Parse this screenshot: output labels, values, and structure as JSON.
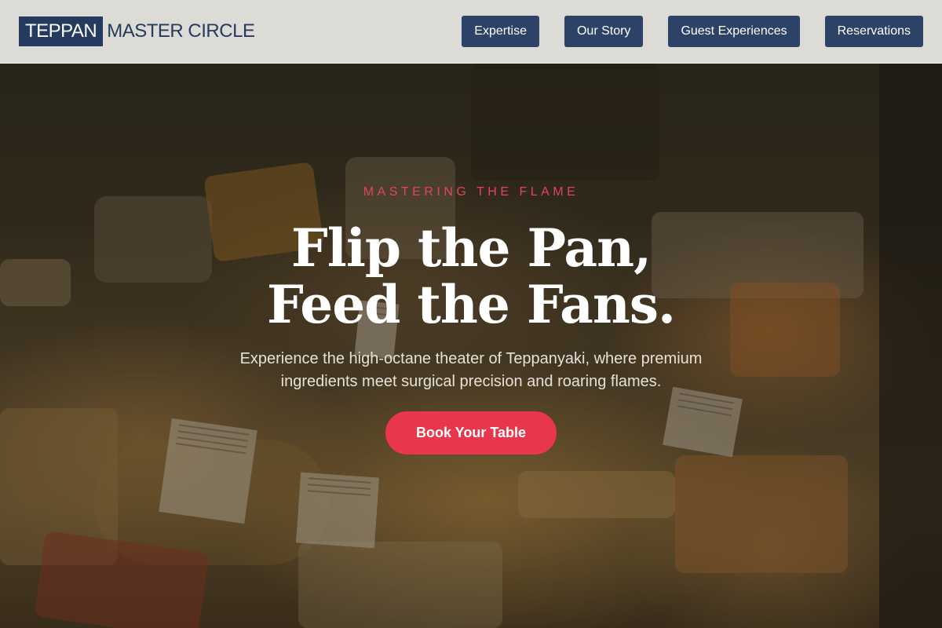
{
  "brand": {
    "logo_box_text": "TEPPAN",
    "logo_rest_text": "MASTER CIRCLE"
  },
  "nav": {
    "items": [
      {
        "label": "Expertise"
      },
      {
        "label": "Our Story"
      },
      {
        "label": "Guest Experiences"
      },
      {
        "label": "Reservations"
      }
    ]
  },
  "hero": {
    "eyebrow": "MASTERING THE FLAME",
    "headline_line1": "Flip the Pan,",
    "headline_line2": "Feed the Fans.",
    "subtext": "Experience the high-octane theater of Teppanyaki, where premium ingredients meet surgical precision and roaring flames.",
    "cta_label": "Book Your Table"
  },
  "colors": {
    "brand_navy": "#243a5e",
    "nav_button": "#2c4266",
    "accent_red": "#e8374c",
    "eyebrow_red": "#e0455a"
  }
}
